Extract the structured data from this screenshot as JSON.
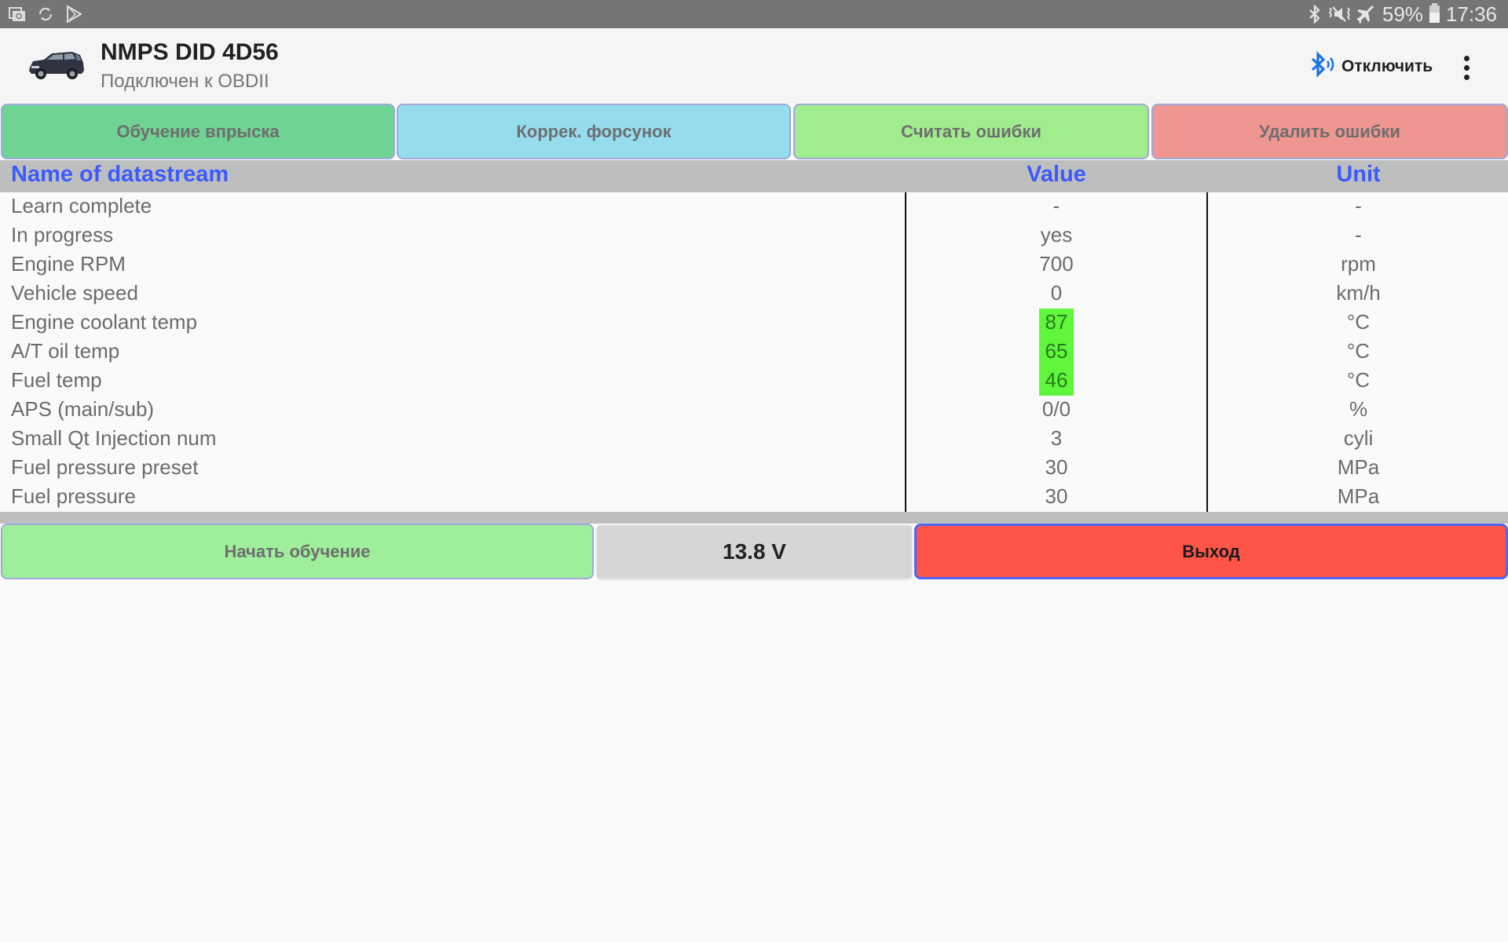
{
  "status_bar": {
    "left_icons": [
      "screenshot-icon",
      "sync-icon",
      "play-store-icon"
    ],
    "right_icons": [
      "bluetooth-icon",
      "mute-icon",
      "airplane-mode-icon"
    ],
    "battery": "59%",
    "time": "17:36"
  },
  "app_bar": {
    "title": "NMPS DID 4D56",
    "subtitle": "Подключен к OBDII",
    "disconnect_label": "Отключить",
    "colors": {
      "bluetooth": "#1a73e8"
    }
  },
  "top_buttons": [
    {
      "label": "Обучение впрыска",
      "color": "#6fd393"
    },
    {
      "label": "Коррек. форсунок",
      "color": "#95dded"
    },
    {
      "label": "Считать ошибки",
      "color": "#a0ec8e"
    },
    {
      "label": "Удалить ошибки",
      "color": "#ef9690"
    }
  ],
  "table": {
    "headers": {
      "name": "Name of datastream",
      "value": "Value",
      "unit": "Unit"
    },
    "rows": [
      {
        "name": "Learn complete",
        "value": "-",
        "unit": "-",
        "highlight": false
      },
      {
        "name": "In progress",
        "value": "yes",
        "unit": "-",
        "highlight": false
      },
      {
        "name": "Engine RPM",
        "value": "700",
        "unit": "rpm",
        "highlight": false
      },
      {
        "name": "Vehicle speed",
        "value": "0",
        "unit": "km/h",
        "highlight": false
      },
      {
        "name": "Engine coolant temp",
        "value": "87",
        "unit": "°C",
        "highlight": true
      },
      {
        "name": "A/T oil temp",
        "value": "65",
        "unit": "°C",
        "highlight": true
      },
      {
        "name": "Fuel temp",
        "value": "46",
        "unit": "°C",
        "highlight": true
      },
      {
        "name": "APS (main/sub)",
        "value": "0/0",
        "unit": "%",
        "highlight": false
      },
      {
        "name": "Small Qt Injection num",
        "value": "3",
        "unit": "cyli",
        "highlight": false
      },
      {
        "name": "Fuel pressure preset",
        "value": "30",
        "unit": "MPa",
        "highlight": false
      },
      {
        "name": "Fuel pressure",
        "value": "30",
        "unit": "MPa",
        "highlight": false
      }
    ],
    "highlight_color": "#60f63c"
  },
  "bottom": {
    "start_learning_label": "Начать обучение",
    "start_learning_color": "#9eee9b",
    "voltage": "13.8 V",
    "exit_label": "Выход",
    "exit_color": "#ff5549"
  }
}
